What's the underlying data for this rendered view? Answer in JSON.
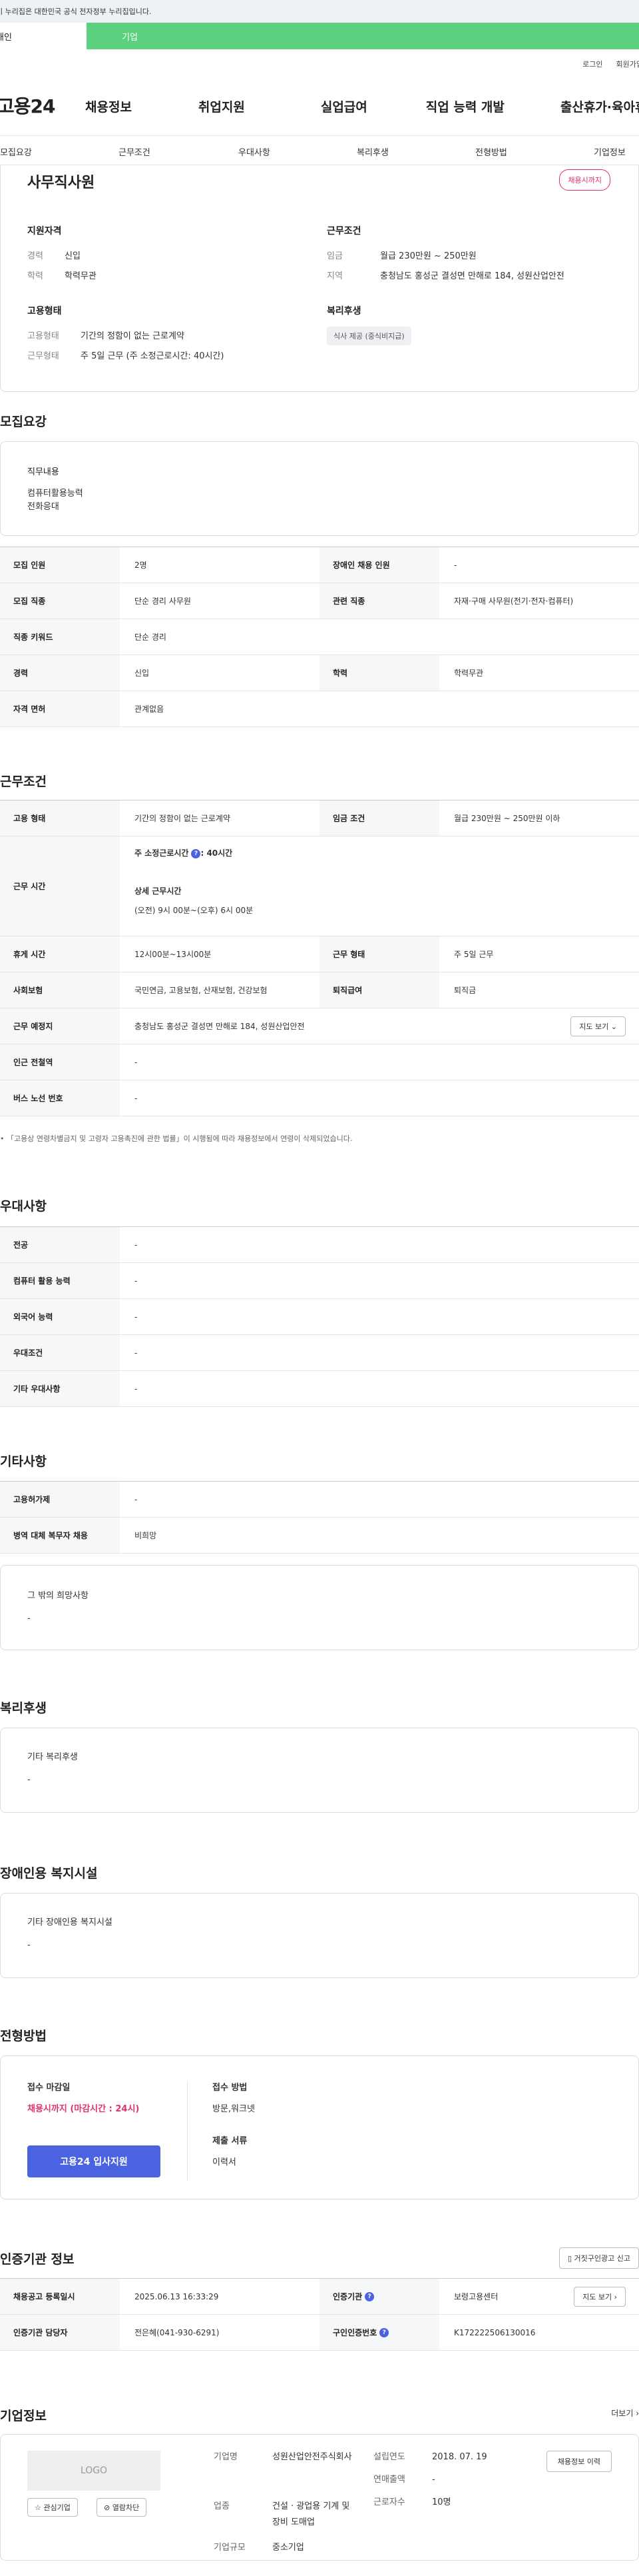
{
  "gov_banner": "이 누리집은 대한민국 공식 전자정부 누리집입니다.",
  "user_tabs": [
    "개인",
    "기업"
  ],
  "util_links": [
    "로그인",
    "회원가입"
  ],
  "logo": "고용24",
  "gnb": [
    "채용정보",
    "취업지원",
    "실업급여",
    "직업 능력 개발",
    "출산휴가·육아휴직"
  ],
  "tabs": [
    "모집요강",
    "근무조건",
    "우대사항",
    "복리후생",
    "전형방법",
    "기업정보"
  ],
  "summary": {
    "title": "사무직사원",
    "badge": "채용시까지",
    "qual_heading": "지원자격",
    "career_k": "경력",
    "career_v": "신입",
    "edu_k": "학력",
    "edu_v": "학력무관",
    "cond_heading": "근무조건",
    "wage_k": "임금",
    "wage_v": "월급 230만원 ~ 250만원",
    "area_k": "지역",
    "area_v": "충청남도 홍성군 결성면 만해로 184, 성원산업안전",
    "employ_heading": "고용형태",
    "etype_k": "고용형태",
    "etype_v": "기간의 정함이 없는 근로계약",
    "wform_k": "근무형태",
    "wform_v": "주 5일 근무 (주 소정근로시간: 40시간)",
    "welfare_heading": "복리후생",
    "welfare_chip": "식사 제공 (중식비지급)"
  },
  "recruit": {
    "title": "모집요강",
    "duty_h": "직무내용",
    "duty_lines": [
      "컴퓨터활용능력",
      "전화응대"
    ],
    "rows": [
      {
        "k1": "모집 인원",
        "v1": "2명",
        "k2": "장애인 채용 인원",
        "v2": "-"
      },
      {
        "k1": "모집 직종",
        "v1": "단순 경리 사무원",
        "k2": "관련 직종",
        "v2": "자재·구매 사무원(전기·전자·컴퓨터)"
      },
      {
        "k1": "직종 키워드",
        "v1": "단순 경리"
      },
      {
        "k1": "경력",
        "v1": "신입",
        "k2": "학력",
        "v2": "학력무관"
      },
      {
        "k1": "자격 면허",
        "v1": "관계없음"
      }
    ]
  },
  "work": {
    "title": "근무조건",
    "r1": {
      "k1": "고용 형태",
      "v1": "기간의 정함이 없는 근로계약",
      "k2": "임금 조건",
      "v2": "월급 230만원 ~ 250만원 이하"
    },
    "hours_k": "근무 시간",
    "hours_a": "주 소정근로시간",
    "hours_a2": ": 40시간",
    "hours_b": "상세 근무시간",
    "hours_c": "(오전) 9시 00분~(오후) 6시 00분",
    "r3": {
      "k1": "휴게 시간",
      "v1": "12시00분~13시00분",
      "k2": "근무 형태",
      "v2": "주 5일 근무"
    },
    "r4": {
      "k1": "사회보험",
      "v1": "국민연금, 고용보험, 산재보험, 건강보험",
      "k2": "퇴직급여",
      "v2": "퇴직금"
    },
    "r5": {
      "k1": "근무 예정지",
      "v1": "충청남도 홍성군 결성면 만해로 184, 성원산업안전",
      "btn": "지도 보기"
    },
    "r6": {
      "k1": "인근 전철역",
      "v1": "-"
    },
    "r7": {
      "k1": "버스 노선 번호",
      "v1": "-"
    },
    "note": "「고용상 연령차별금지 및 고령자 고용촉진에 관한 법률」이 시행됨에 따라 채용정보에서 연령이 삭제되었습니다."
  },
  "pref": {
    "title": "우대사항",
    "rows": [
      {
        "k": "전공",
        "v": "-"
      },
      {
        "k": "컴퓨터 활용 능력",
        "v": "-"
      },
      {
        "k": "외국어 능력",
        "v": "-"
      },
      {
        "k": "우대조건",
        "v": "-"
      },
      {
        "k": "기타 우대사항",
        "v": "-"
      }
    ]
  },
  "etc": {
    "title": "기타사항",
    "rows": [
      {
        "k": "고용허가제",
        "v": "-"
      },
      {
        "k": "병역 대체 복무자 채용",
        "v": "비희망"
      }
    ],
    "extra_h": "그 밖의 희망사항",
    "extra_v": "-"
  },
  "welfare": {
    "title": "복리후생",
    "h": "기타 복리후생",
    "v": "-"
  },
  "disabled": {
    "title": "장애인용 복지시설",
    "h": "기타 장애인용 복지시설",
    "v": "-"
  },
  "process": {
    "title": "전형방법",
    "deadline_h": "접수 마감일",
    "deadline_v": "채용시까지 (마감시간 : 24시)",
    "method_h": "접수 방법",
    "method_v": "방문,워크넷",
    "docs_h": "제출 서류",
    "docs_v": "이력서",
    "apply_btn": "고용24 입사지원"
  },
  "agency": {
    "title": "인증기관 정보",
    "report_btn": "거짓구인광고 신고",
    "r1": {
      "k1": "채용공고 등록일시",
      "v1": "2025.06.13 16:33:29",
      "k2": "인증기관",
      "v2": "보령고용센터",
      "btn": "지도 보기"
    },
    "r2": {
      "k1": "인증기관 담당자",
      "v1": "전은혜(041-930-6291)",
      "k2": "구인인증번호",
      "v2": "K172222506130016"
    }
  },
  "company": {
    "title": "기업정보",
    "more": "더보기",
    "logo_ph": "LOGO",
    "fav_btn": "관심기업",
    "block_btn": "열람차단",
    "name_k": "기업명",
    "name_v": "성원산업안전주식회사",
    "industry_k": "업종",
    "industry_v": "건설 · 광업용 기계 및 장비 도매업",
    "size_k": "기업규모",
    "size_v": "중소기업",
    "founded_k": "설립연도",
    "founded_v": "2018. 07. 19",
    "sales_k": "연매출액",
    "sales_v": "-",
    "emp_k": "근로자수",
    "emp_v": "10명",
    "history_btn": "채용정보 이력"
  }
}
